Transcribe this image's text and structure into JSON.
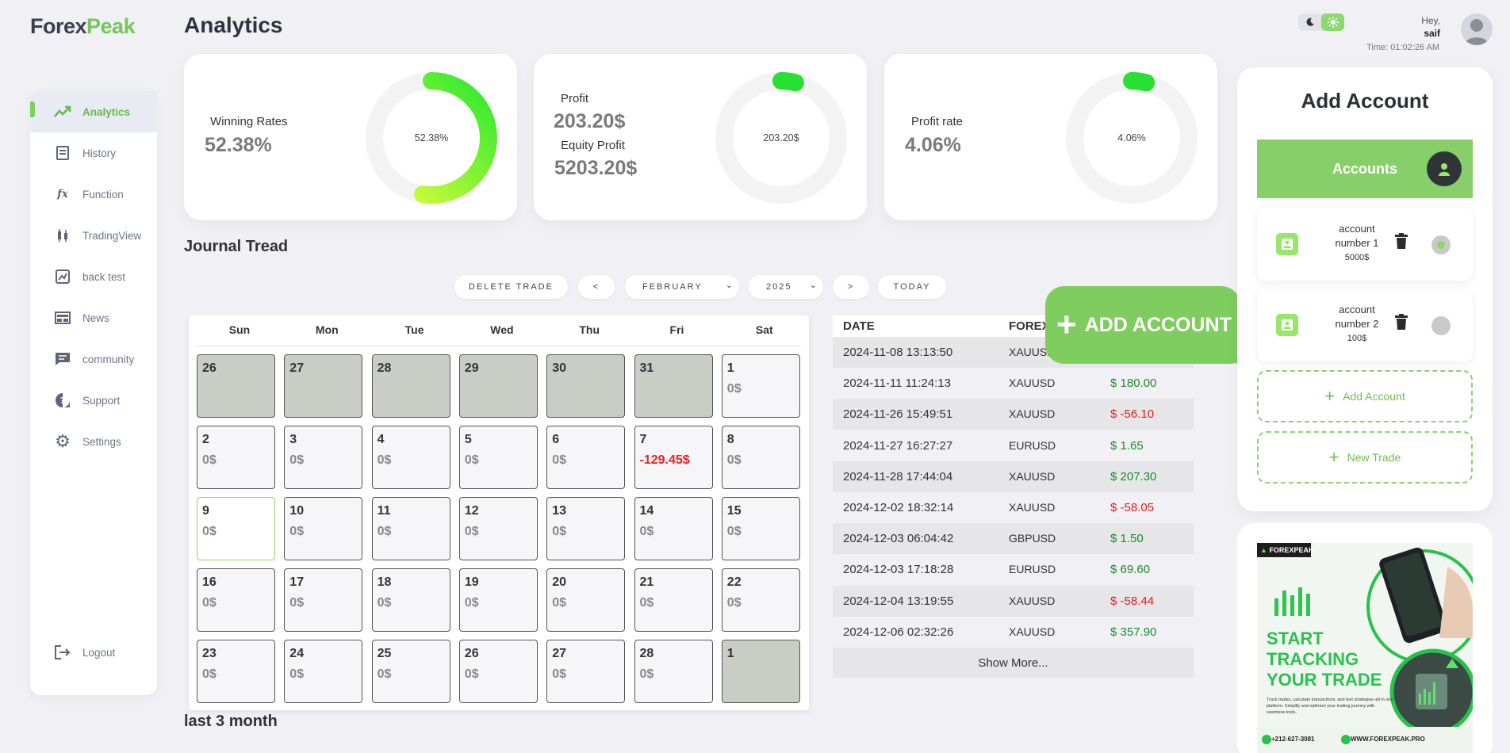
{
  "brand": {
    "part1": "Forex",
    "part2": "Peak"
  },
  "page_title": "Analytics",
  "nav": [
    {
      "label": "Analytics",
      "icon": "analytics-icon",
      "active": true
    },
    {
      "label": "History",
      "icon": "history-icon"
    },
    {
      "label": "Function",
      "icon": "function-icon"
    },
    {
      "label": "TradingView",
      "icon": "candles-icon"
    },
    {
      "label": "back test",
      "icon": "chart-icon"
    },
    {
      "label": "News",
      "icon": "news-icon"
    },
    {
      "label": "community",
      "icon": "chat-icon"
    },
    {
      "label": "Support",
      "icon": "help-icon"
    },
    {
      "label": "Settings",
      "icon": "gear-icon"
    }
  ],
  "logout": {
    "label": "Logout",
    "icon": "logout-icon"
  },
  "user": {
    "greet": "Hey,",
    "name": "saif",
    "time": "Time: 01:02:26 AM"
  },
  "theme": {
    "moon_icon": "moon-icon",
    "sun_icon": "sun-icon",
    "active": "light",
    "accent": "#8dd870"
  },
  "stats": {
    "winning": {
      "label": "Winning Rates",
      "value": "52.38%",
      "gauge_label": "52.38%",
      "fraction": 0.5238
    },
    "profit": {
      "label": "Profit",
      "value": "203.20$",
      "equity_label": "Equity Profit",
      "equity_value": "5203.20$",
      "gauge_label": "203.20$",
      "fraction": 0.04
    },
    "rate": {
      "label": "Profit rate",
      "value": "4.06%",
      "gauge_label": "4.06%",
      "fraction": 0.0406
    }
  },
  "journal": {
    "title": "Journal Tread",
    "delete_label": "DELETE TRADE",
    "prev_label": "<",
    "next_label": ">",
    "month": "FEBRUARY",
    "year": "2025",
    "today_label": "TODAY"
  },
  "calendar": {
    "weekdays": [
      "Sun",
      "Mon",
      "Tue",
      "Wed",
      "Thu",
      "Fri",
      "Sat"
    ],
    "weeks": [
      [
        {
          "d": "26",
          "o": true
        },
        {
          "d": "27",
          "o": true
        },
        {
          "d": "28",
          "o": true
        },
        {
          "d": "29",
          "o": true
        },
        {
          "d": "30",
          "o": true
        },
        {
          "d": "31",
          "o": true
        },
        {
          "d": "1",
          "v": "0$"
        }
      ],
      [
        {
          "d": "2",
          "v": "0$"
        },
        {
          "d": "3",
          "v": "0$"
        },
        {
          "d": "4",
          "v": "0$"
        },
        {
          "d": "5",
          "v": "0$"
        },
        {
          "d": "6",
          "v": "0$"
        },
        {
          "d": "7",
          "v": "-129.45$",
          "neg": true
        },
        {
          "d": "8",
          "v": "0$"
        }
      ],
      [
        {
          "d": "9",
          "v": "0$",
          "today": true
        },
        {
          "d": "10",
          "v": "0$"
        },
        {
          "d": "11",
          "v": "0$"
        },
        {
          "d": "12",
          "v": "0$"
        },
        {
          "d": "13",
          "v": "0$"
        },
        {
          "d": "14",
          "v": "0$"
        },
        {
          "d": "15",
          "v": "0$"
        }
      ],
      [
        {
          "d": "16",
          "v": "0$"
        },
        {
          "d": "17",
          "v": "0$"
        },
        {
          "d": "18",
          "v": "0$"
        },
        {
          "d": "19",
          "v": "0$"
        },
        {
          "d": "20",
          "v": "0$"
        },
        {
          "d": "21",
          "v": "0$"
        },
        {
          "d": "22",
          "v": "0$"
        }
      ],
      [
        {
          "d": "23",
          "v": "0$"
        },
        {
          "d": "24",
          "v": "0$"
        },
        {
          "d": "25",
          "v": "0$"
        },
        {
          "d": "26",
          "v": "0$"
        },
        {
          "d": "27",
          "v": "0$"
        },
        {
          "d": "28",
          "v": "0$"
        },
        {
          "d": "1",
          "o": true
        }
      ]
    ]
  },
  "trades": {
    "headers": [
      "DATE",
      "FOREX"
    ],
    "rows": [
      {
        "date": "2024-11-08 13:13:50",
        "pair": "XAUUSD",
        "pnl": "",
        "sign": ""
      },
      {
        "date": "2024-11-11 11:24:13",
        "pair": "XAUUSD",
        "pnl": "$ 180.00",
        "sign": "pos"
      },
      {
        "date": "2024-11-26 15:49:51",
        "pair": "XAUUSD",
        "pnl": "$ -56.10",
        "sign": "neg"
      },
      {
        "date": "2024-11-27 16:27:27",
        "pair": "EURUSD",
        "pnl": "$ 1.65",
        "sign": "pos"
      },
      {
        "date": "2024-11-28 17:44:04",
        "pair": "XAUUSD",
        "pnl": "$ 207.30",
        "sign": "pos"
      },
      {
        "date": "2024-12-02 18:32:14",
        "pair": "XAUUSD",
        "pnl": "$ -58.05",
        "sign": "neg"
      },
      {
        "date": "2024-12-03 06:04:42",
        "pair": "GBPUSD",
        "pnl": "$ 1.50",
        "sign": "pos"
      },
      {
        "date": "2024-12-03 17:18:28",
        "pair": "EURUSD",
        "pnl": "$ 69.60",
        "sign": "pos"
      },
      {
        "date": "2024-12-04 13:19:55",
        "pair": "XAUUSD",
        "pnl": "$ -58.44",
        "sign": "neg"
      },
      {
        "date": "2024-12-06 02:32:26",
        "pair": "XAUUSD",
        "pnl": "$ 357.90",
        "sign": "pos"
      }
    ],
    "show_more": "Show More..."
  },
  "bubble": {
    "label": "ADD ACCOUNT",
    "plus": "+"
  },
  "accounts_panel": {
    "title": "Add Account",
    "bar_label": "Accounts",
    "accounts": [
      {
        "line1": "account",
        "line2": "number 1",
        "balance": "5000$",
        "selected": true
      },
      {
        "line1": "account",
        "line2": "number 2",
        "balance": "100$",
        "selected": false
      }
    ],
    "add_label": "Add Account",
    "trade_label": "New Trade"
  },
  "ad": {
    "brand": "FOREXPEAK",
    "headline": [
      "START",
      "TRACKING",
      "YOUR TRADE"
    ],
    "blurb": "Track trades, calculate transactions, and test strategies–all in one platform. Simplify and optimize your trading journey with seamless tools.",
    "phone": "+212-627-3081",
    "site": "WWW.FOREXPEAK.PRO"
  },
  "last3": {
    "title": "last 3 month"
  }
}
